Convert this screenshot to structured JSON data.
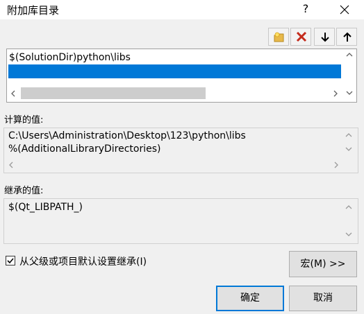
{
  "window": {
    "title": "附加库目录",
    "help_label": "?"
  },
  "toolbar": {
    "icons": [
      "new-folder-icon",
      "delete-icon",
      "move-down-icon",
      "move-up-icon"
    ],
    "delete_color": "#c42b1c"
  },
  "list": {
    "items": [
      "$(SolutionDir)python\\libs",
      ""
    ],
    "selected_index": 1,
    "selection_color": "#0078d7"
  },
  "evaluated": {
    "label": "计算的值:",
    "lines": [
      "C:\\Users\\Administration\\Desktop\\123\\python\\libs",
      "%(AdditionalLibraryDirectories)"
    ]
  },
  "inherited": {
    "label": "继承的值:",
    "lines": [
      "$(Qt_LIBPATH_)"
    ]
  },
  "inherit_checkbox": {
    "label": "从父级或项目默认设置继承(I)",
    "checked": true
  },
  "buttons": {
    "macros": "宏(M) >>",
    "ok": "确定",
    "cancel": "取消"
  }
}
